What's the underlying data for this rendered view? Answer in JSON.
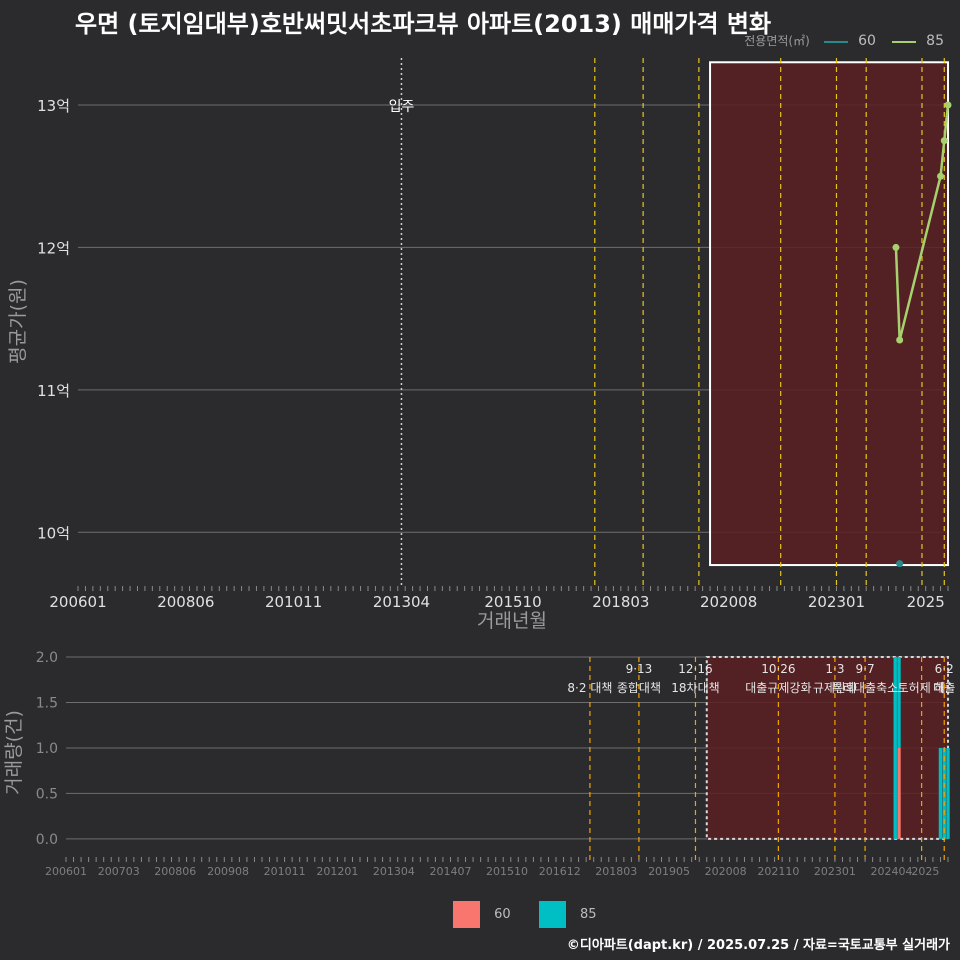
{
  "page": {
    "title": "우면 (토지임대부)호반써밋서초파크뷰 아파트(2013) 매매가격 변화",
    "footer": "©디아파트(dapt.kr) / 2025.07.25 / 자료=국토교통부 실거래가"
  },
  "colors": {
    "background": "#2b2b2d",
    "series_60": "#2a8a8a",
    "series_85": "#a7d16e",
    "bar_60": "#f8766d",
    "bar_85": "#00bfc4",
    "policy_line": "#e6c619",
    "shade": "#5a1e22"
  },
  "chart_data": [
    {
      "type": "line",
      "ylabel": "평균가(원)",
      "xlabel": "거래년월",
      "x_ticks": [
        "200601",
        "200806",
        "201011",
        "201304",
        "201510",
        "201803",
        "202008",
        "202301",
        "2025"
      ],
      "y_ticks": [
        "10억",
        "11억",
        "12억",
        "13억"
      ],
      "y_tick_values": [
        100000,
        110000,
        120000,
        130000
      ],
      "ylim": [
        96300,
        133300
      ],
      "legend": {
        "title": "전용면적(㎡)",
        "position": "top-right",
        "entries": [
          "60",
          "85"
        ]
      },
      "annotations": [
        {
          "x": "2013-04",
          "label": "입주"
        }
      ],
      "policy_lines": [
        "2017-08",
        "2018-09",
        "2019-12",
        "2021-10",
        "2023-01",
        "2023-09",
        "2024-12",
        "2025-06"
      ],
      "shaded_range": [
        "2020-03",
        "2025-07"
      ],
      "series": [
        {
          "name": "60",
          "x": [
            "2024-06"
          ],
          "y": [
            97800
          ]
        },
        {
          "name": "85",
          "x": [
            "2024-05",
            "2024-06",
            "2025-05",
            "2025-06",
            "2025-07"
          ],
          "y": [
            120000,
            113500,
            125000,
            127500,
            130000
          ]
        }
      ]
    },
    {
      "type": "bar",
      "ylabel": "거래량(건)",
      "x_ticks": [
        "200601",
        "200703",
        "200806",
        "200908",
        "201011",
        "201201",
        "201304",
        "201407",
        "201510",
        "201612",
        "201803",
        "201905",
        "202008",
        "202110",
        "202301",
        "202404",
        "2025"
      ],
      "y_ticks": [
        "0.0",
        "0.5",
        "1.0",
        "1.5",
        "2.0"
      ],
      "y_tick_values": [
        0,
        0.5,
        1.0,
        1.5,
        2.0
      ],
      "ylim": [
        -0.1,
        2.0
      ],
      "shaded_range": [
        "2020-03",
        "2025-07"
      ],
      "policy_labels": [
        {
          "x": "2017-08",
          "line1": "",
          "line2": "8·2 대책"
        },
        {
          "x": "2018-09",
          "line1": "9·13",
          "line2": "종합대책"
        },
        {
          "x": "2019-12",
          "line1": "12·16",
          "line2": "18차대책"
        },
        {
          "x": "2021-10",
          "line1": "10·26",
          "line2": "대출규제강화"
        },
        {
          "x": "2023-01",
          "line1": "1·3",
          "line2": "규제완화"
        },
        {
          "x": "2023-09",
          "line1": "9·7",
          "line2": "특례대출축소"
        },
        {
          "x": "2024-12",
          "line1": "",
          "line2": "토허제 해"
        },
        {
          "x": "2025-06",
          "line1": "6·2",
          "line2": "대출"
        }
      ],
      "series": [
        {
          "name": "60",
          "x": [
            "2024-06"
          ],
          "values": [
            1
          ]
        },
        {
          "name": "85",
          "x": [
            "2024-05",
            "2024-06",
            "2025-05",
            "2025-06",
            "2025-07"
          ],
          "values": [
            2,
            1,
            1,
            1,
            1
          ]
        }
      ]
    }
  ]
}
